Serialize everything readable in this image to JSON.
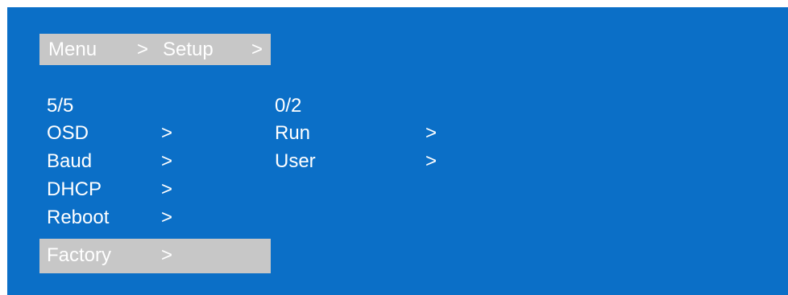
{
  "breadcrumb": {
    "items": [
      "Menu",
      ">",
      "Setup",
      ">"
    ]
  },
  "left_menu": {
    "counter": "5/5",
    "items": [
      {
        "label": "OSD",
        "arrow": ">"
      },
      {
        "label": "Baud",
        "arrow": ">"
      },
      {
        "label": "DHCP",
        "arrow": ">"
      },
      {
        "label": "Reboot",
        "arrow": ">"
      },
      {
        "label": "Factory",
        "arrow": ">"
      }
    ],
    "selected_index": 4
  },
  "right_menu": {
    "counter": "0/2",
    "items": [
      {
        "label": "Run",
        "arrow": ">"
      },
      {
        "label": "User",
        "arrow": ">"
      }
    ]
  },
  "colors": {
    "background": "#0b6fc7",
    "highlight": "#c7c7c7",
    "text": "#ffffff"
  }
}
